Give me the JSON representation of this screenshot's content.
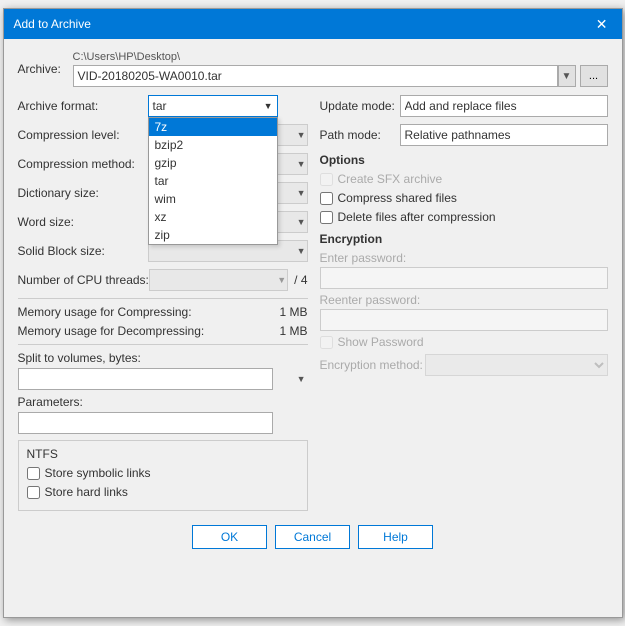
{
  "dialog": {
    "title": "Add to Archive",
    "close_label": "✕"
  },
  "archive": {
    "label": "Archive:",
    "path_line1": "C:\\Users\\HP\\Desktop\\",
    "path_value": "VID-20180205-WA0010.tar",
    "browse_label": "..."
  },
  "left": {
    "format_label": "Archive format:",
    "format_value": "tar",
    "format_options": [
      "7z",
      "bzip2",
      "gzip",
      "tar",
      "wim",
      "xz",
      "zip"
    ],
    "format_highlighted": "7z",
    "compression_label": "Compression level:",
    "compression_value": "",
    "method_label": "Compression method:",
    "method_value": "",
    "dict_label": "Dictionary size:",
    "dict_value": "",
    "word_label": "Word size:",
    "word_value": "",
    "solid_label": "Solid Block size:",
    "solid_value": "",
    "cpu_label": "Number of CPU threads:",
    "cpu_value": "",
    "cpu_of": "/ 4",
    "mem_compress_label": "Memory usage for Compressing:",
    "mem_compress_value": "1 MB",
    "mem_decompress_label": "Memory usage for Decompressing:",
    "mem_decompress_value": "1 MB",
    "split_label": "Split to volumes, bytes:",
    "split_value": "",
    "params_label": "Parameters:",
    "params_value": "",
    "ntfs_title": "NTFS",
    "store_symlinks_label": "Store symbolic links",
    "store_hardlinks_label": "Store hard links"
  },
  "right": {
    "update_label": "Update mode:",
    "update_value": "Add and replace files",
    "path_mode_label": "Path mode:",
    "path_mode_value": "Relative pathnames",
    "options_title": "Options",
    "create_sfx_label": "Create SFX archive",
    "compress_shared_label": "Compress shared files",
    "delete_after_label": "Delete files after compression",
    "encryption_title": "Encryption",
    "enter_password_label": "Enter password:",
    "enter_password_placeholder": "",
    "reenter_password_label": "Reenter password:",
    "reenter_password_placeholder": "",
    "show_password_label": "Show Password",
    "enc_method_label": "Encryption method:",
    "enc_method_value": ""
  },
  "buttons": {
    "ok_label": "OK",
    "cancel_label": "Cancel",
    "help_label": "Help"
  }
}
